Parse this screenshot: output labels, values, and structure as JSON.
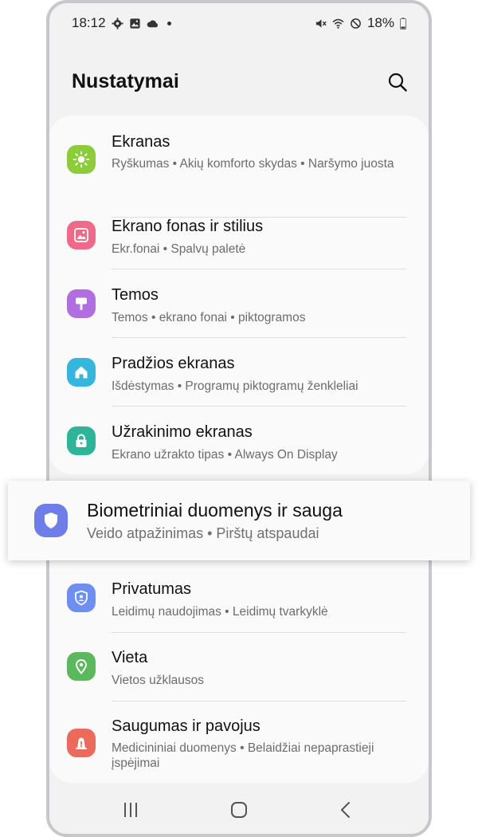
{
  "status_bar": {
    "time": "18:12",
    "battery": "18%",
    "icons_left": [
      "settings-icon",
      "image-icon",
      "cloud-icon"
    ],
    "icons_right": [
      "mute-icon",
      "wifi-icon",
      "do-not-disturb-icon",
      "battery-icon"
    ]
  },
  "header": {
    "title": "Nustatymai"
  },
  "settings_items": [
    {
      "label": "Ekranas",
      "sub": "Ryškumas • Akių komforto skydas • Naršymo juosta",
      "icon": "sun-icon",
      "color": "#8ccb3a"
    },
    {
      "label": "Ekrano fonas ir stilius",
      "sub": "Ekr.fonai • Spalvų paletė",
      "icon": "wallpaper-icon",
      "color": "#ef6a8a"
    },
    {
      "label": "Temos",
      "sub": "Temos • ekrano fonai • piktogramos",
      "icon": "brush-icon",
      "color": "#b06ee0"
    },
    {
      "label": "Pradžios ekranas",
      "sub": "Išdėstymas • Programų piktogramų ženkleliai",
      "icon": "home-icon",
      "color": "#37b6dd"
    },
    {
      "label": "Užrakinimo ekranas",
      "sub": "Ekrano užrakto tipas • Always On Display",
      "icon": "lock-icon",
      "color": "#2fb49a"
    }
  ],
  "highlighted_item": {
    "label": "Biometriniai duomenys ir sauga",
    "sub": "Veido atpažinimas • Pirštų atspaudai",
    "icon": "shield-icon",
    "color": "#6e7de8"
  },
  "settings_items_after": [
    {
      "label": "Privatumas",
      "sub": "Leidimų naudojimas • Leidimų tvarkyklė",
      "icon": "privacy-shield-icon",
      "color": "#6c8ff0"
    },
    {
      "label": "Vieta",
      "sub": "Vietos užklausos",
      "icon": "location-pin-icon",
      "color": "#5cb85c"
    },
    {
      "label": "Saugumas ir pavojus",
      "sub": "Medicininiai duomenys • Belaidžiai nepaprastieji įspėjimai",
      "icon": "alert-icon",
      "color": "#ec6a5c"
    }
  ],
  "nav_bar": [
    "recent-apps-icon",
    "home-button-icon",
    "back-icon"
  ]
}
